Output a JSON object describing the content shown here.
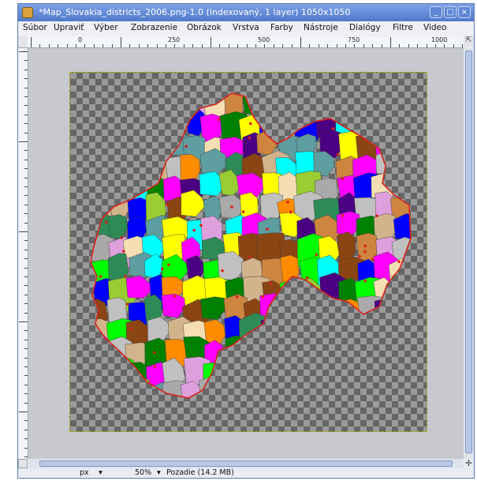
{
  "window": {
    "title": "*Map_Slovakia_districts_2006.png-1.0 (indexovaný, 1 layer) 1050x1050",
    "minimize_glyph": "_",
    "maximize_glyph": "□",
    "close_glyph": "×"
  },
  "menu": {
    "items": [
      "Súbor",
      "Upraviť",
      "Výber",
      "Zobrazenie",
      "Obrázok",
      "Vrstva",
      "Farby",
      "Nástroje",
      "Dialógy",
      "Filtre",
      "Video"
    ]
  },
  "ruler": {
    "labels": [
      "0",
      "250",
      "500",
      "750",
      "1000"
    ]
  },
  "statusbar": {
    "unit": "px",
    "zoom": "50%",
    "info": "Pozadie (14.2 MB)",
    "dropdown_glyph": "▾"
  },
  "icons": {
    "navigate": "navigate-icon",
    "quick_mask": "quick-mask-icon",
    "app": "gimp-app-icon"
  },
  "map": {
    "image_name": "Map_Slovakia_districts_2006.png",
    "colors": [
      "#ff00ff",
      "#00ffff",
      "#ffff00",
      "#00ff00",
      "#0000ff",
      "#ff8c00",
      "#8b4513",
      "#a9a9a9",
      "#f5deb3",
      "#d2b48c",
      "#008000",
      "#4b0082",
      "#9acd32",
      "#dda0dd",
      "#c0c0c0",
      "#2e8b57",
      "#5f9ea0",
      "#cd853f"
    ]
  }
}
